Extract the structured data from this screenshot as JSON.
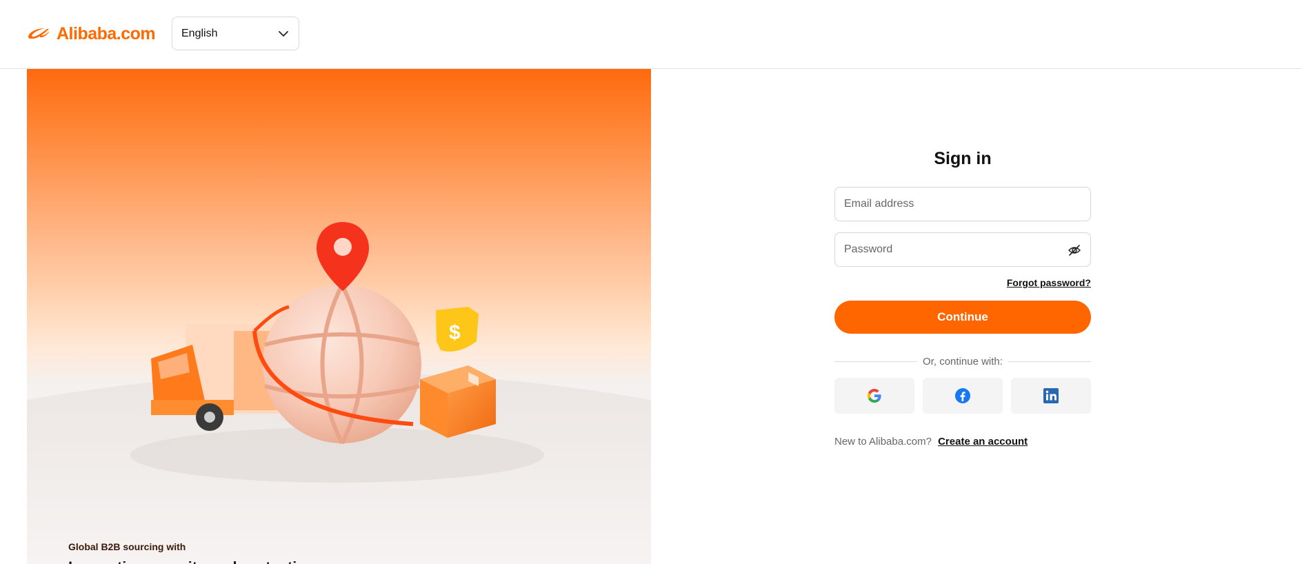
{
  "header": {
    "logo_text": "Alibaba.com",
    "language": {
      "selected": "English",
      "icon": "chevron-down-icon"
    }
  },
  "hero": {
    "caption": "Global B2B sourcing with",
    "headline": "Innovative security and protection"
  },
  "signin": {
    "title": "Sign in",
    "email": {
      "value": "",
      "placeholder": "Email address"
    },
    "password": {
      "value": "",
      "placeholder": "Password",
      "toggle_icon": "eye-off-icon"
    },
    "forgot_label": "Forgot password?",
    "continue_label": "Continue",
    "divider_text": "Or, continue with:",
    "socials": [
      {
        "name": "Google",
        "icon": "google-icon"
      },
      {
        "name": "Facebook",
        "icon": "facebook-icon"
      },
      {
        "name": "LinkedIn",
        "icon": "linkedin-icon"
      }
    ],
    "new_prompt": "New to Alibaba.com?",
    "create_label": "Create an account"
  },
  "colors": {
    "brand_orange": "#ff6a00",
    "button_orange": "#ff6600",
    "facebook_blue": "#1877f2",
    "linkedin_blue": "#2867b2"
  }
}
